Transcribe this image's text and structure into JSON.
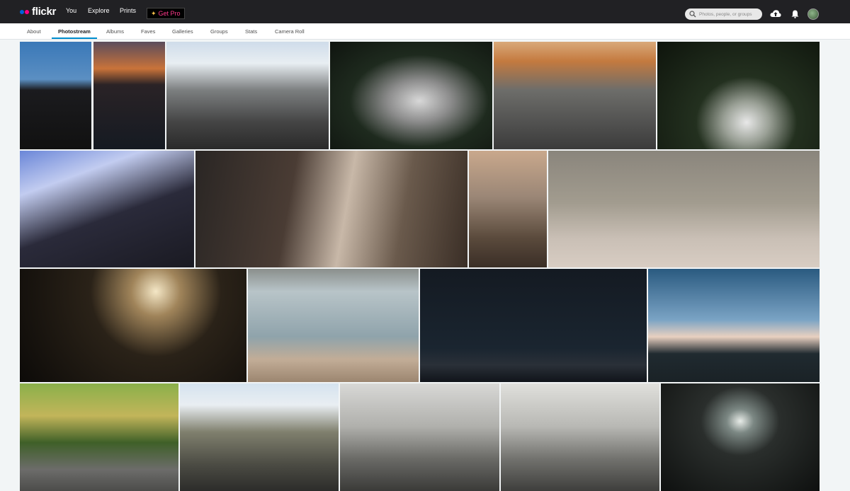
{
  "header": {
    "logo_text": "flickr",
    "nav": [
      "You",
      "Explore",
      "Prints"
    ],
    "get_pro_label": "Get Pro",
    "search_placeholder": "Photos, people, or groups"
  },
  "subnav": {
    "items": [
      "About",
      "Photostream",
      "Albums",
      "Faves",
      "Galleries",
      "Groups",
      "Stats",
      "Camera Roll"
    ],
    "active": "Photostream"
  },
  "photos": [
    {
      "name": "black-hatchback",
      "bg": "linear-gradient(180deg,#3a78b8 0%,#5b8fc2 35%,#1b1b1e 45%,#111 100%)"
    },
    {
      "name": "sunset-sea",
      "bg": "linear-gradient(180deg,#5b4c5c 0%,#c9733a 25%,#2a2326 40%,#151a22 100%)"
    },
    {
      "name": "sedan-wall-motion",
      "bg": "linear-gradient(180deg,#cfdcea 0%,#e8eef2 20%,#7c7f80 45%,#444 75%,#2a2a2a 100%)"
    },
    {
      "name": "white-celica",
      "bg": "radial-gradient(ellipse at 55% 55%,#d8d8d8 0%,#8c8c8c 25%,#1e2a1e 55%,#0f140f 100%)"
    },
    {
      "name": "sedan-road-autumn",
      "bg": "linear-gradient(180deg,#d9a97a 0%,#c47a3f 18%,#6d6d6a 45%,#3b3b3b 100%)"
    },
    {
      "name": "white-rx7",
      "bg": "radial-gradient(ellipse at 55% 75%,#e8e8e8 0%,#9aa096 18%,#23301f 40%,#0e140c 100%)"
    },
    {
      "name": "club-group",
      "bg": "linear-gradient(160deg,#6a86d8 0%,#c2ccf0 25%,#2a2a3a 55%,#1a1a22 100%)"
    },
    {
      "name": "cafe-portrait",
      "bg": "linear-gradient(100deg,#2a2624 0%,#4a3c34 35%,#c8b8a8 55%,#6a5a4c 75%,#3a2e26 100%)"
    },
    {
      "name": "water-bottle-portrait",
      "bg": "linear-gradient(180deg,#c9a88c 0%,#9a8676 40%,#5a4a3c 75%,#3a2e26 100%)"
    },
    {
      "name": "camera-petals",
      "bg": "linear-gradient(180deg,#8a857c 0%,#a29c8f 45%,#c9bfb5 75%,#d8cdc3 100%)"
    },
    {
      "name": "concert-stage",
      "bg": "radial-gradient(circle at 60% 20%,#f4e7c6 0%,#a0845a 15%,#2a2218 40%,#0c0a08 100%)"
    },
    {
      "name": "beach-walkers",
      "bg": "linear-gradient(180deg,#8a8f8c 0%,#b8c4c8 20%,#8fa3ab 60%,#c2ad97 80%,#9c8670 100%)"
    },
    {
      "name": "night-sky",
      "bg": "linear-gradient(180deg,#141a22 0%,#1a2530 70%,#2a3038 85%,#10141a 100%)"
    },
    {
      "name": "dusk-shore",
      "bg": "linear-gradient(180deg,#2a5a80 0%,#7aa3c4 45%,#e8d0c0 60%,#202a30 75%,#1a2226 100%)"
    },
    {
      "name": "green-roadster-forest",
      "bg": "linear-gradient(180deg,#8ab04a 0%,#c2b55a 30%,#3f6028 55%,#6c6c6a 80%,#4c4c4a 100%)"
    },
    {
      "name": "sedan-wall-motion-2",
      "bg": "linear-gradient(180deg,#d5e3ef 0%,#e9eef2 20%,#80806e 45%,#4c4c44 75%,#2c2c2a 100%)"
    },
    {
      "name": "black-mr2-garage",
      "bg": "linear-gradient(180deg,#d8d8d6 0%,#b0b0ac 40%,#6a6a66 70%,#3a3a38 100%)"
    },
    {
      "name": "black-mr2-garage-2",
      "bg": "linear-gradient(180deg,#e0e0dc 0%,#b8b8b4 40%,#72726e 70%,#3e3e3c 100%)"
    },
    {
      "name": "concert-crowd",
      "bg": "radial-gradient(ellipse at 50% 35%,#e8ece8 0%,#7c8884 12%,#2a2e2c 35%,#0e100f 100%)"
    }
  ]
}
